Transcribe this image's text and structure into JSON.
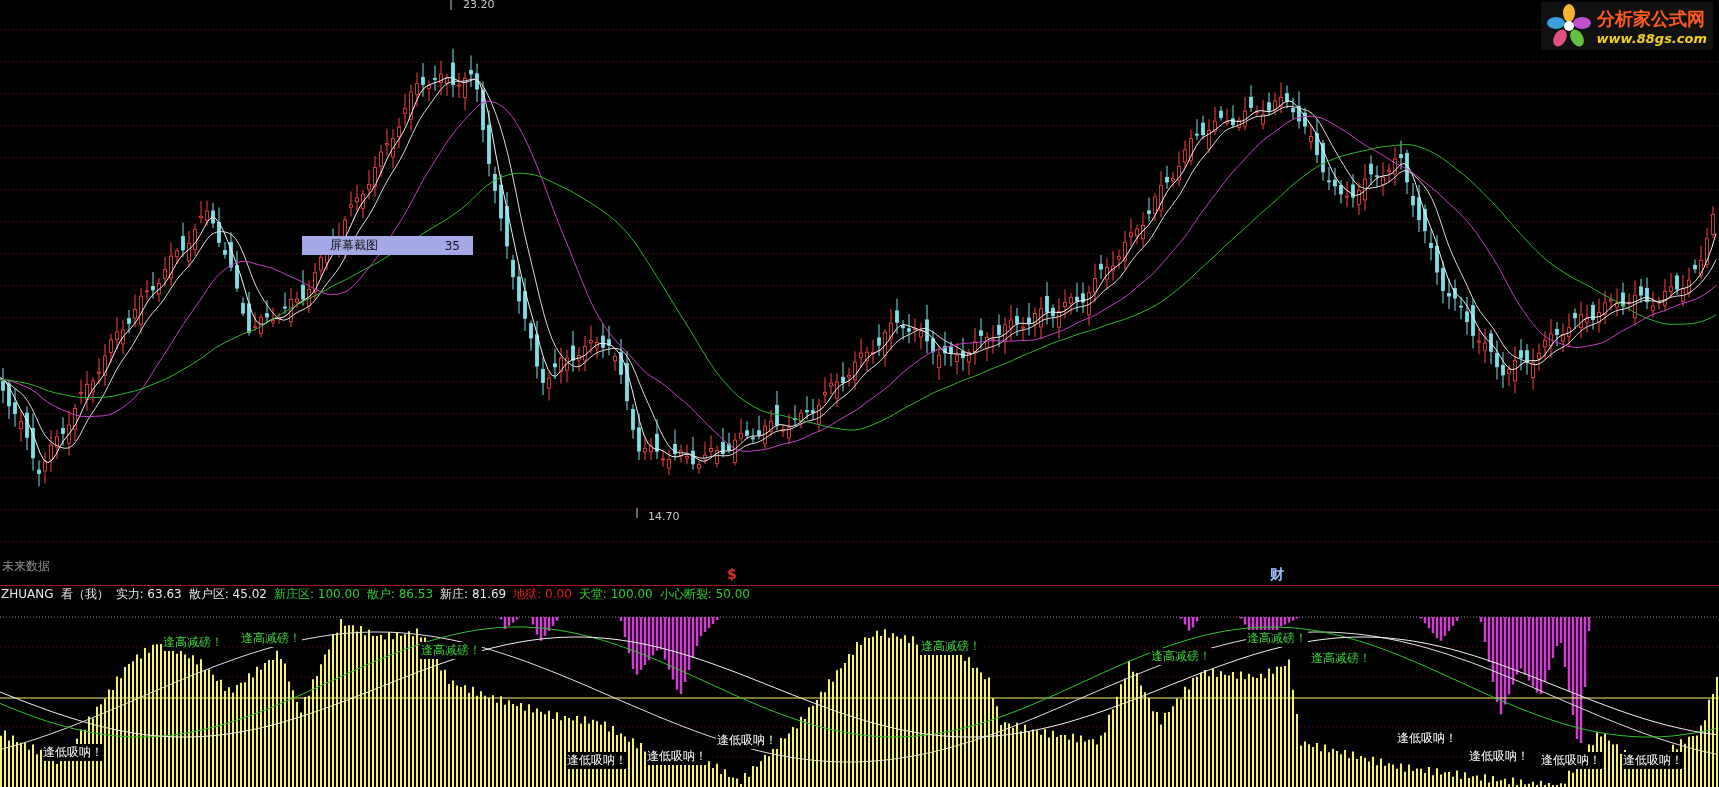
{
  "chart_labels": {
    "high": "23.20",
    "low": "14.70"
  },
  "tooltip": {
    "label": "屏幕截图",
    "value": "35"
  },
  "logo": {
    "name": "分析家公式网",
    "url": "www.88gs.com"
  },
  "future_data_label": "未来数据",
  "event_markers": [
    {
      "text": "$",
      "color": "#e0302f"
    },
    {
      "text": "财",
      "color": "#9cc4ff"
    }
  ],
  "indicator": {
    "name": "ZHUANG",
    "mode": "看（我）",
    "readings": [
      {
        "label": "实力:",
        "value": "63.63",
        "color": "#e8e8e8"
      },
      {
        "label": "散户区:",
        "value": "45.02",
        "color": "#e8e8e8"
      },
      {
        "label": "新庄区:",
        "value": "100.00",
        "color": "#33cc33"
      },
      {
        "label": "散户:",
        "value": "86.53",
        "color": "#33cc33"
      },
      {
        "label": "新庄:",
        "value": "81.69",
        "color": "#e8e8e8"
      },
      {
        "label": "地狱:",
        "value": "0.00",
        "color": "#e02020"
      },
      {
        "label": "天堂:",
        "value": "100.00",
        "color": "#33cc33"
      },
      {
        "label": "小心断裂:",
        "value": "50.00",
        "color": "#33cc33"
      }
    ]
  },
  "signals": [
    {
      "kind": "sell",
      "text": "逢高减磅！"
    },
    {
      "kind": "sell",
      "text": "逢高减磅！"
    },
    {
      "kind": "sell",
      "text": "逢高减磅！"
    },
    {
      "kind": "sell",
      "text": "逢高减磅！"
    },
    {
      "kind": "sell",
      "text": "逢高减磅！"
    },
    {
      "kind": "sell",
      "text": "逢高减磅！"
    },
    {
      "kind": "sell",
      "text": "逢高减磅！"
    },
    {
      "kind": "buy",
      "text": "逢低吸呐！"
    },
    {
      "kind": "buy",
      "text": "逢低吸呐！"
    },
    {
      "kind": "buy",
      "text": "逢低吸呐！"
    },
    {
      "kind": "buy",
      "text": "逢低吸呐！"
    },
    {
      "kind": "buy",
      "text": "逢低吸呐！"
    },
    {
      "kind": "buy",
      "text": "逢低吸呐！"
    },
    {
      "kind": "buy",
      "text": "逢低吸呐！"
    },
    {
      "kind": "buy",
      "text": "逢低吸呐！"
    }
  ]
}
